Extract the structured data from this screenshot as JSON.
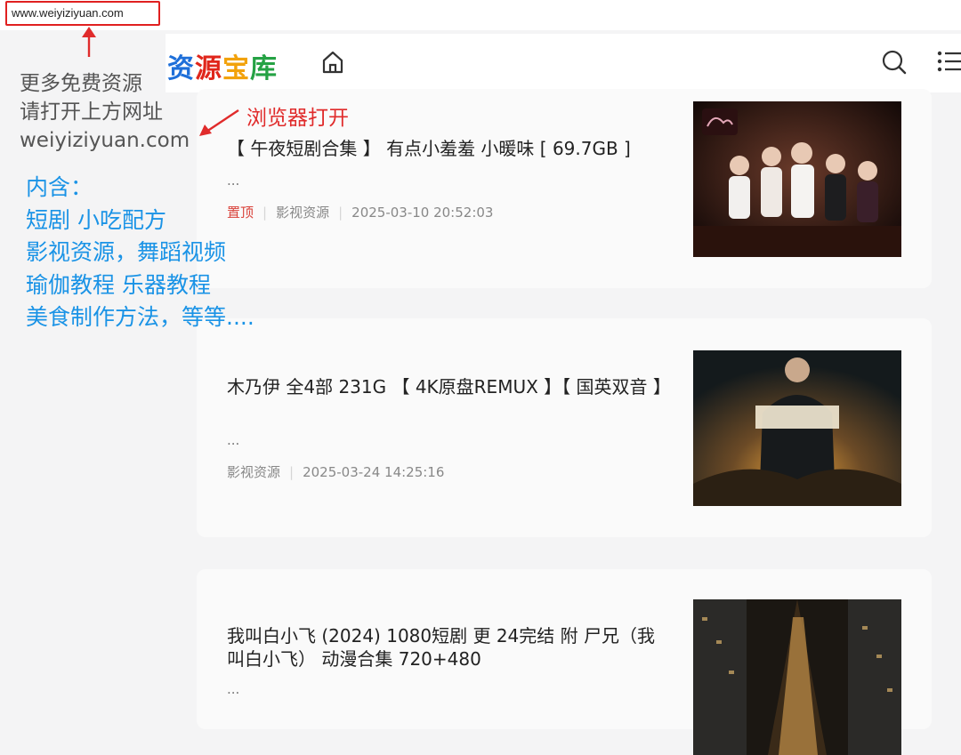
{
  "browser": {
    "url": "www.weiyiziyuan.com"
  },
  "site": {
    "logo_chars": [
      "资",
      "源",
      "宝",
      "库"
    ],
    "icons": [
      "home-icon",
      "search-icon",
      "menu-list-icon"
    ]
  },
  "posts": [
    {
      "title": "【 午夜短剧合集 】 有点小羞羞 小暖味 [ 69.7GB ]",
      "excerpt": "...",
      "pinned_label": "置顶",
      "category": "影视资源",
      "datetime": "2025-03-10 20:52:03"
    },
    {
      "title": "木乃伊 全4部 231G 【 4K原盘REMUX 】【 国英双音 】",
      "excerpt": "...",
      "category": "影视资源",
      "datetime": "2025-03-24 14:25:16"
    },
    {
      "title": "我叫白小飞 (2024) 1080短剧 更 24完结 附 尸兄（我叫白小飞） 动漫合集 720+480",
      "excerpt": "..."
    }
  ],
  "annotations": {
    "gray_lines": [
      "更多免费资源",
      "请打开上方网址",
      "weiyiziyuan.com"
    ],
    "red_text": "浏览器打开",
    "blue_lines": [
      "内含：",
      "短剧 小吃配方",
      "影视资源，舞蹈视频",
      "瑜伽教程 乐器教程",
      "美食制作方法，等等...."
    ]
  },
  "colors": {
    "annotation_red": "#e02b2b",
    "annotation_blue": "#1a93e6",
    "pinned_red": "#d9433b"
  }
}
